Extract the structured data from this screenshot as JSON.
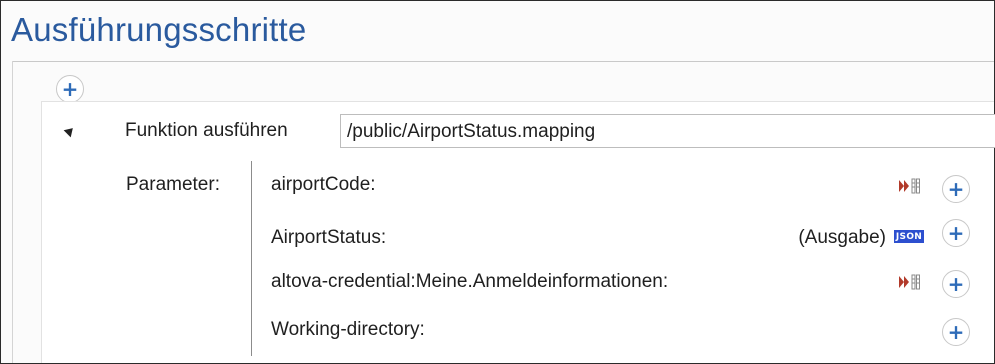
{
  "page": {
    "title": "Ausführungsschritte"
  },
  "step": {
    "label": "Funktion ausführen",
    "path": "/public/AirportStatus.mapping"
  },
  "parameters": {
    "label": "Parameter:",
    "rows": [
      {
        "name": "airportCode:",
        "output": "",
        "icon": "mapping-input-icon"
      },
      {
        "name": "AirportStatus:",
        "output": "(Ausgabe)",
        "icon": "json-icon"
      },
      {
        "name": "altova-credential:Meine.Anmeldeinformationen:",
        "output": "",
        "icon": "mapping-input-icon"
      },
      {
        "name": "Working-directory:",
        "output": "",
        "icon": ""
      }
    ]
  },
  "icons": {
    "json_badge_text": "JSON"
  },
  "colors": {
    "title": "#2a5a9e",
    "plus": "#2e6bb8",
    "json_badge": "#2d4fcf",
    "mapping_icon": "#b23a2a"
  }
}
